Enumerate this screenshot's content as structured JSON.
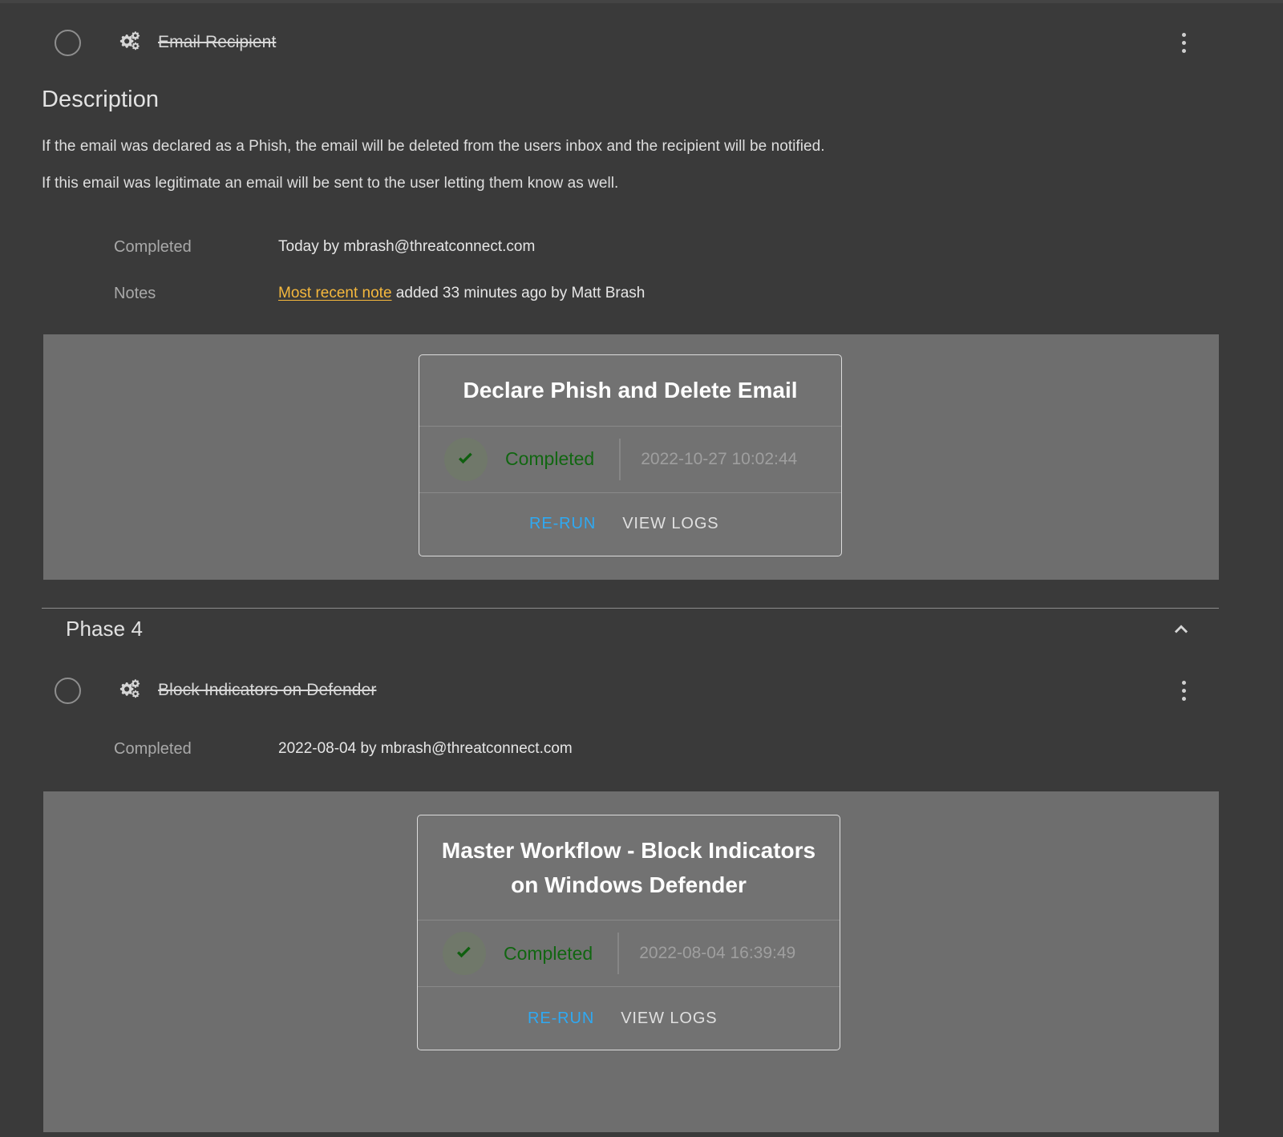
{
  "theme": {
    "page_bg": "#3a3a3a",
    "panel_bg": "#6e6e6e",
    "card_bg": "#727272",
    "accent_link": "#2fa9f2",
    "note_link": "#f5b83d",
    "status_complete": "#116611"
  },
  "task1": {
    "status_icon": "empty-circle-icon",
    "type_icon": "cogs-icon",
    "title": "Email Recipient",
    "menu_icon": "kebab-menu-icon",
    "description_heading": "Description",
    "description_lines": [
      "If the email was declared as a Phish, the email will be deleted from the users inbox and the recipient will be notified.",
      "If this email was legitimate an email will be sent to the user letting them know as well."
    ],
    "meta": [
      {
        "label": "Completed",
        "value": "Today by mbrash@threatconnect.com"
      },
      {
        "label": "Notes",
        "link_text": "Most recent note",
        "value_suffix": " added 33 minutes ago by Matt Brash"
      }
    ],
    "card": {
      "title": "Declare Phish and Delete Email",
      "status_icon": "check-icon",
      "status_text": "Completed",
      "timestamp": "2022-10-27 10:02:44",
      "actions": {
        "rerun": "RE-RUN",
        "view_logs": "VIEW LOGS"
      }
    }
  },
  "phase4": {
    "title": "Phase 4",
    "collapse_icon": "chevron-up-icon",
    "task": {
      "status_icon": "empty-circle-icon",
      "type_icon": "cogs-icon",
      "title": "Block Indicators on Defender",
      "menu_icon": "kebab-menu-icon",
      "meta": [
        {
          "label": "Completed",
          "value": "2022-08-04 by mbrash@threatconnect.com"
        }
      ],
      "card": {
        "title": "Master Workflow - Block Indicators on Windows Defender",
        "status_icon": "check-icon",
        "status_text": "Completed",
        "timestamp": "2022-08-04 16:39:49",
        "actions": {
          "rerun": "RE-RUN",
          "view_logs": "VIEW LOGS"
        }
      }
    }
  }
}
